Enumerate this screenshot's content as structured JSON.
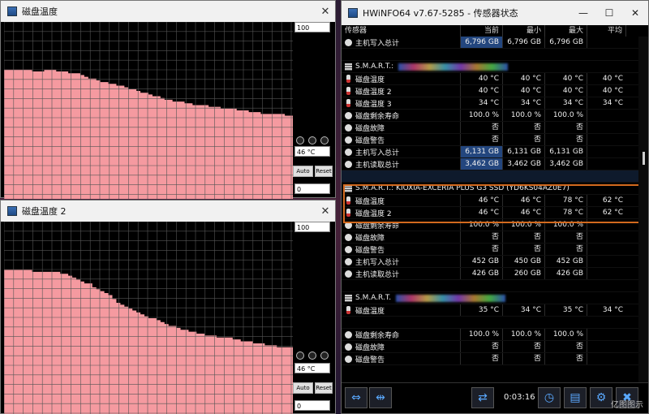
{
  "graph1": {
    "title": "磁盘温度",
    "max": "100",
    "current": "46 °C",
    "min": "0",
    "auto_fit": "Auto Fit",
    "reset": "Reset",
    "levels": [
      0.73,
      0.73,
      0.73,
      0.73,
      0.73,
      0.73,
      0.73,
      0.72,
      0.72,
      0.72,
      0.73,
      0.73,
      0.73,
      0.72,
      0.72,
      0.72,
      0.71,
      0.71,
      0.71,
      0.7,
      0.69,
      0.68,
      0.68,
      0.67,
      0.66,
      0.66,
      0.65,
      0.65,
      0.64,
      0.64,
      0.63,
      0.62,
      0.62,
      0.61,
      0.6,
      0.6,
      0.59,
      0.58,
      0.58,
      0.57,
      0.56,
      0.56,
      0.55,
      0.55,
      0.55,
      0.54,
      0.54,
      0.53,
      0.53,
      0.53,
      0.53,
      0.52,
      0.52,
      0.52,
      0.51,
      0.51,
      0.51,
      0.51,
      0.5,
      0.5,
      0.5,
      0.49,
      0.49,
      0.49,
      0.48,
      0.48,
      0.48,
      0.48,
      0.48,
      0.48,
      0.47,
      0.47
    ]
  },
  "graph2": {
    "title": "磁盘温度 2",
    "max": "100",
    "current": "46 °C",
    "min": "0",
    "auto_fit": "Auto Fit",
    "reset": "Reset",
    "levels": [
      0.75,
      0.75,
      0.75,
      0.75,
      0.75,
      0.75,
      0.75,
      0.74,
      0.74,
      0.74,
      0.74,
      0.74,
      0.74,
      0.74,
      0.73,
      0.73,
      0.72,
      0.71,
      0.7,
      0.69,
      0.68,
      0.68,
      0.66,
      0.65,
      0.64,
      0.63,
      0.62,
      0.6,
      0.58,
      0.57,
      0.56,
      0.55,
      0.54,
      0.53,
      0.52,
      0.51,
      0.5,
      0.5,
      0.49,
      0.48,
      0.47,
      0.46,
      0.46,
      0.45,
      0.44,
      0.44,
      0.43,
      0.43,
      0.42,
      0.42,
      0.41,
      0.41,
      0.41,
      0.4,
      0.4,
      0.4,
      0.4,
      0.39,
      0.39,
      0.38,
      0.38,
      0.38,
      0.37,
      0.37,
      0.37,
      0.36,
      0.36,
      0.36,
      0.35,
      0.35,
      0.35,
      0.35
    ]
  },
  "main": {
    "title": "HWiNFO64 v7.67-5285 - 传感器状态",
    "headers": [
      "传感器",
      "当前",
      "最小",
      "最大",
      "平均"
    ],
    "rows": [
      {
        "type": "value",
        "icon": "circle",
        "label": "主机写入总计",
        "cur": "6,796 GB",
        "min": "6,796 GB",
        "max": "6,796 GB",
        "avg": "",
        "hl": true
      },
      {
        "type": "blank"
      },
      {
        "type": "header",
        "label": "S.M.A.R.T.:",
        "blurred": true
      },
      {
        "type": "value",
        "icon": "temp",
        "label": "磁盘温度",
        "cur": "40 °C",
        "min": "40 °C",
        "max": "40 °C",
        "avg": "40 °C"
      },
      {
        "type": "value",
        "icon": "temp",
        "label": "磁盘温度 2",
        "cur": "40 °C",
        "min": "40 °C",
        "max": "40 °C",
        "avg": "40 °C"
      },
      {
        "type": "value",
        "icon": "temp",
        "label": "磁盘温度 3",
        "cur": "34 °C",
        "min": "34 °C",
        "max": "34 °C",
        "avg": "34 °C"
      },
      {
        "type": "value",
        "icon": "circle",
        "label": "磁盘剩余寿命",
        "cur": "100.0 %",
        "min": "100.0 %",
        "max": "100.0 %",
        "avg": ""
      },
      {
        "type": "value",
        "icon": "circle",
        "label": "磁盘故障",
        "cur": "否",
        "min": "否",
        "max": "否",
        "avg": ""
      },
      {
        "type": "value",
        "icon": "circle",
        "label": "磁盘警告",
        "cur": "否",
        "min": "否",
        "max": "否",
        "avg": ""
      },
      {
        "type": "value",
        "icon": "circle",
        "label": "主机写入总计",
        "cur": "6,131 GB",
        "min": "6,131 GB",
        "max": "6,131 GB",
        "avg": "",
        "hl": true
      },
      {
        "type": "value",
        "icon": "circle",
        "label": "主机读取总计",
        "cur": "3,462 GB",
        "min": "3,462 GB",
        "max": "3,462 GB",
        "avg": "",
        "hl": true
      },
      {
        "type": "blank",
        "sel": true
      },
      {
        "type": "header",
        "label": "S.M.A.R.T.: KIOXIA-EXCERIA PLUS G3 SSD (YD6KS04AZ0E7)"
      },
      {
        "type": "value",
        "icon": "temp",
        "label": "磁盘温度",
        "cur": "46 °C",
        "min": "46 °C",
        "max": "78 °C",
        "avg": "62 °C"
      },
      {
        "type": "value",
        "icon": "temp",
        "label": "磁盘温度 2",
        "cur": "46 °C",
        "min": "46 °C",
        "max": "78 °C",
        "avg": "62 °C"
      },
      {
        "type": "value",
        "icon": "circle",
        "label": "磁盘剩余寿命",
        "cur": "100.0 %",
        "min": "100.0 %",
        "max": "100.0 %",
        "avg": ""
      },
      {
        "type": "value",
        "icon": "circle",
        "label": "磁盘故障",
        "cur": "否",
        "min": "否",
        "max": "否",
        "avg": ""
      },
      {
        "type": "value",
        "icon": "circle",
        "label": "磁盘警告",
        "cur": "否",
        "min": "否",
        "max": "否",
        "avg": ""
      },
      {
        "type": "value",
        "icon": "circle",
        "label": "主机写入总计",
        "cur": "452 GB",
        "min": "450 GB",
        "max": "452 GB",
        "avg": ""
      },
      {
        "type": "value",
        "icon": "circle",
        "label": "主机读取总计",
        "cur": "426 GB",
        "min": "260 GB",
        "max": "426 GB",
        "avg": ""
      },
      {
        "type": "blank"
      },
      {
        "type": "header",
        "label": "S.M.A.R.T.",
        "blurred": true
      },
      {
        "type": "value",
        "icon": "temp",
        "label": "磁盘温度",
        "cur": "35 °C",
        "min": "34 °C",
        "max": "35 °C",
        "avg": "34 °C"
      },
      {
        "type": "blank"
      },
      {
        "type": "value",
        "icon": "circle",
        "label": "磁盘剩余寿命",
        "cur": "100.0 %",
        "min": "100.0 %",
        "max": "100.0 %",
        "avg": ""
      },
      {
        "type": "value",
        "icon": "circle",
        "label": "磁盘故障",
        "cur": "否",
        "min": "否",
        "max": "否",
        "avg": ""
      },
      {
        "type": "value",
        "icon": "circle",
        "label": "磁盘警告",
        "cur": "否",
        "min": "否",
        "max": "否",
        "avg": ""
      }
    ],
    "timer": "0:03:16",
    "watermark": "亿图图示"
  }
}
